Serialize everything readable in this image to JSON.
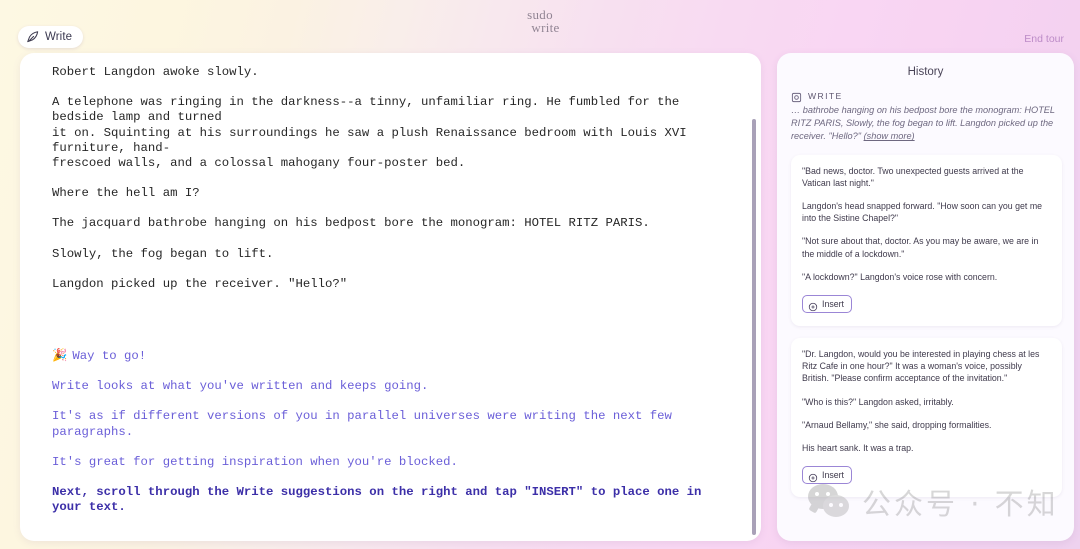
{
  "topbar": {
    "write_button_label": "Write",
    "write_button_icon": "quill-pen-icon",
    "logo_line1": "sudo",
    "logo_line2": "write",
    "end_tour_label": "End tour"
  },
  "editor": {
    "paragraphs": [
      {
        "text": "Robert Langdon awoke slowly.",
        "style": "normal"
      },
      {
        "text": "A telephone was ringing in the darkness--a tinny, unfamiliar ring. He fumbled for the bedside lamp and turned\nit on. Squinting at his surroundings he saw a plush Renaissance bedroom with Louis XVI furniture, hand-\nfrescoed walls, and a colossal mahogany four-poster bed.",
        "style": "normal"
      },
      {
        "text": "Where the hell am I?",
        "style": "normal"
      },
      {
        "text": "The jacquard bathrobe hanging on his bedpost bore the monogram: HOTEL RITZ PARIS.",
        "style": "normal"
      },
      {
        "text": "Slowly, the fog began to lift.",
        "style": "normal"
      },
      {
        "text": "Langdon picked up the receiver. \"Hello?\"",
        "style": "normal"
      }
    ],
    "hints": {
      "celebrate_emoji": "🎉",
      "celebrate_text": "Way to go!",
      "line1": "Write looks at what you've written and keeps going.",
      "line2": "It's as if different versions of you in parallel universes were writing the next few paragraphs.",
      "line3": "It's great for getting inspiration when you're blocked.",
      "line4": "Next, scroll through the Write suggestions on the right and tap \"INSERT\" to place one in your text."
    }
  },
  "history": {
    "title": "History",
    "group": {
      "icon": "write-stamp-icon",
      "label": "WRITE",
      "excerpt": "… bathrobe hanging on his bedpost bore the monogram: HOTEL RITZ PARIS, Slowly, the fog began to lift. Langdon picked up the receiver. \"Hello?\" ",
      "show_more_label": "(show more)"
    },
    "suggestions": [
      {
        "paragraphs": [
          "\"Bad news, doctor. Two unexpected guests arrived at the Vatican last night.\"",
          "Langdon's head snapped forward. \"How soon can you get me into the Sistine Chapel?\"",
          "\"Not sure about that, doctor. As you may be aware, we are in the middle of a lockdown.\"",
          "\"A lockdown?\" Langdon's voice rose with concern."
        ],
        "insert_label": "Insert",
        "insert_icon": "circle-plus-icon"
      },
      {
        "paragraphs": [
          "\"Dr. Langdon, would you be interested in playing chess at les Ritz Cafe in one hour?\" It was a woman's voice, possibly British. \"Please confirm acceptance of the invitation.\"",
          "\"Who is this?\" Langdon asked, irritably.",
          "\"Arnaud Bellamy,\" she said, dropping formalities.",
          "His heart sank. It was a trap."
        ],
        "insert_label": "Insert",
        "insert_icon": "circle-plus-icon"
      }
    ]
  },
  "watermark": {
    "icon": "wechat-icon",
    "text": "公众号 · 不知"
  },
  "colors": {
    "accent_purple": "#6a5ed8",
    "accent_purple_bold": "#3c2fa8",
    "insert_border": "#9b86d6",
    "end_tour": "#b37fc0"
  }
}
